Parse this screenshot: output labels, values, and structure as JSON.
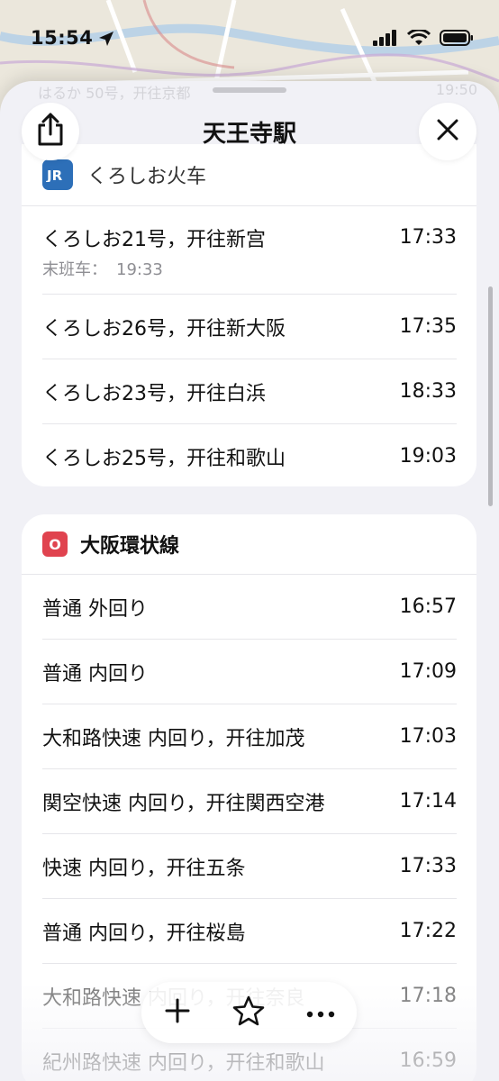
{
  "status_bar": {
    "time": "15:54"
  },
  "header": {
    "title": "天王寺駅"
  },
  "ghost_text": {
    "left": "はるか 50号，开往京都",
    "right": "19:50"
  },
  "sections": [
    {
      "name": "くろしお火车",
      "badge": "JR",
      "rows": [
        {
          "name": "くろしお21号，开往新宫",
          "time": "17:33",
          "sub_label": "末班车：",
          "sub_time": "19:33"
        },
        {
          "name": "くろしお26号，开往新大阪",
          "time": "17:35"
        },
        {
          "name": "くろしお23号，开往白浜",
          "time": "18:33"
        },
        {
          "name": "くろしお25号，开往和歌山",
          "time": "19:03"
        }
      ]
    },
    {
      "name": "大阪環状線",
      "badge": "O",
      "badge_color": "#e0434f",
      "rows": [
        {
          "name": "普通 外回り",
          "time": "16:57"
        },
        {
          "name": "普通 内回り",
          "time": "17:09"
        },
        {
          "name": "大和路快速 内回り，开往加茂",
          "time": "17:03"
        },
        {
          "name": "関空快速 内回り，开往関西空港",
          "time": "17:14"
        },
        {
          "name": "快速 内回り，开往五条",
          "time": "17:33"
        },
        {
          "name": "普通 内回り，开往桜島",
          "time": "17:22"
        },
        {
          "name": "大和路快速 内回り，开往奈良",
          "time": "17:18"
        },
        {
          "name": "紀州路快速 内回り，开往和歌山",
          "time": "16:59"
        }
      ]
    }
  ],
  "toolbar": {
    "icons": [
      "plus-icon",
      "star-icon",
      "more-icon"
    ]
  },
  "colors": {
    "accent_jr": "#2d6fb8",
    "sheet_bg": "#f1f1f6"
  }
}
